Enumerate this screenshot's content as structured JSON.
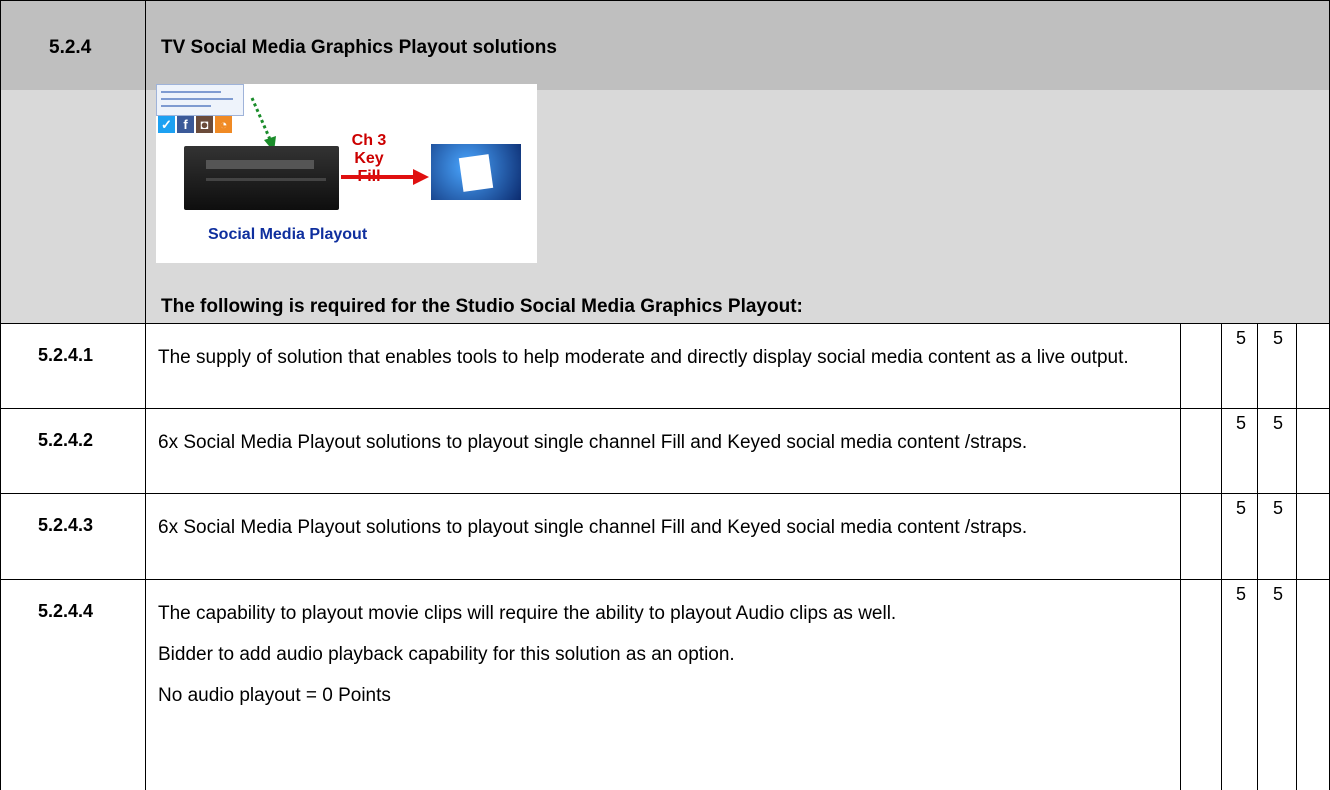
{
  "section": {
    "number": "5.2.4",
    "title": "TV Social Media Graphics Playout solutions"
  },
  "illustration": {
    "channel_label": "Ch 3",
    "key_label": "Key",
    "fill_label": "Fill",
    "caption": "Social Media Playout",
    "social_icons": [
      "twitter-icon",
      "facebook-icon",
      "instagram-icon",
      "rss-icon"
    ]
  },
  "required_heading": "The following is required for the Studio Social Media Graphics Playout:",
  "items": [
    {
      "number": "5.2.4.1",
      "paragraphs": [
        "The supply of solution that enables tools to help moderate and directly display social media content as a live output."
      ],
      "score_a": "5",
      "score_b": "5"
    },
    {
      "number": "5.2.4.2",
      "paragraphs": [
        "6x Social Media Playout solutions to playout single channel Fill and Keyed social media content /straps."
      ],
      "score_a": "5",
      "score_b": "5"
    },
    {
      "number": "5.2.4.3",
      "paragraphs": [
        "6x Social Media Playout solutions to playout single channel Fill and Keyed social media content /straps."
      ],
      "score_a": "5",
      "score_b": "5"
    },
    {
      "number": "5.2.4.4",
      "paragraphs": [
        "The capability to playout movie clips will require the ability to playout Audio clips as well.",
        "Bidder to add audio playback capability for this solution as an option.",
        "No audio playout = 0 Points"
      ],
      "score_a": "5",
      "score_b": "5"
    }
  ]
}
